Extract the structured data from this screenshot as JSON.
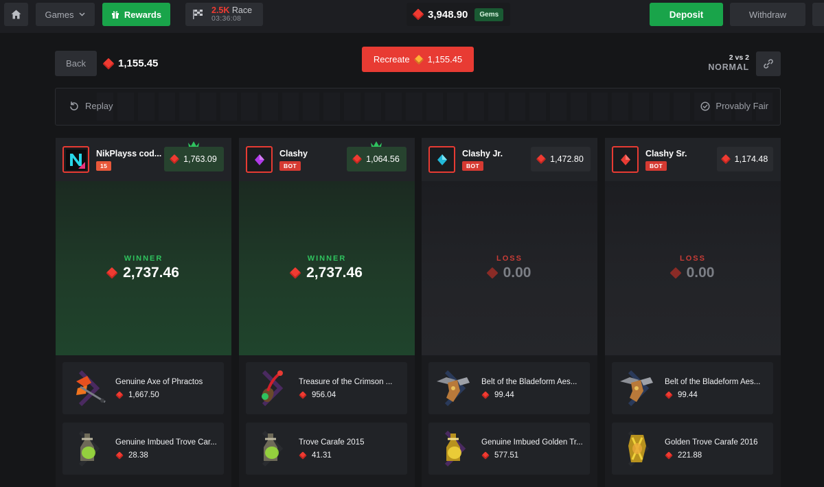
{
  "topbar": {
    "games_label": "Games",
    "rewards_label": "Rewards",
    "race_amount": "2.5K",
    "race_label": "Race",
    "race_timer": "03:36:08",
    "balance": "3,948.90",
    "currency_badge": "Gems",
    "deposit_label": "Deposit",
    "withdraw_label": "Withdraw"
  },
  "battle": {
    "back_label": "Back",
    "cost": "1,155.45",
    "recreate_label": "Recreate",
    "recreate_cost": "1,155.45",
    "mode_players": "2 vs 2",
    "mode_name": "NORMAL",
    "replay_label": "Replay",
    "provably_fair_label": "Provably Fair"
  },
  "players": [
    {
      "name": "NikPlayss cod...",
      "badge": "15",
      "total": "1,763.09",
      "crown": true,
      "result_label": "WINNER",
      "result_amount": "2,737.46",
      "items": [
        {
          "name": "Genuine Axe of Phractos",
          "price": "1,667.50"
        },
        {
          "name": "Genuine Imbued Trove Car...",
          "price": "28.38"
        }
      ]
    },
    {
      "name": "Clashy",
      "badge": "BOT",
      "total": "1,064.56",
      "crown": true,
      "result_label": "WINNER",
      "result_amount": "2,737.46",
      "items": [
        {
          "name": "Treasure of the Crimson ...",
          "price": "956.04"
        },
        {
          "name": "Trove Carafe 2015",
          "price": "41.31"
        }
      ]
    },
    {
      "name": "Clashy Jr.",
      "badge": "BOT",
      "total": "1,472.80",
      "crown": false,
      "result_label": "LOSS",
      "result_amount": "0.00",
      "items": [
        {
          "name": "Belt of the Bladeform Aes...",
          "price": "99.44"
        },
        {
          "name": "Genuine Imbued Golden Tr...",
          "price": "577.51"
        }
      ]
    },
    {
      "name": "Clashy Sr.",
      "badge": "BOT",
      "total": "1,174.48",
      "crown": false,
      "result_label": "LOSS",
      "result_amount": "0.00",
      "items": [
        {
          "name": "Belt of the Bladeform Aes...",
          "price": "99.44"
        },
        {
          "name": "Golden Trove Carafe 2016",
          "price": "221.88"
        }
      ]
    }
  ],
  "colors": {
    "accent_green": "#19a44a",
    "accent_red": "#e83b33",
    "gem_red": "#ef3b32",
    "background": "#151618"
  },
  "icons": [
    "home-icon",
    "chevron-down-icon",
    "gift-icon",
    "race-flag-icon",
    "gem-icon",
    "link-icon",
    "replay-icon",
    "check-circle-icon",
    "crown-icon"
  ]
}
